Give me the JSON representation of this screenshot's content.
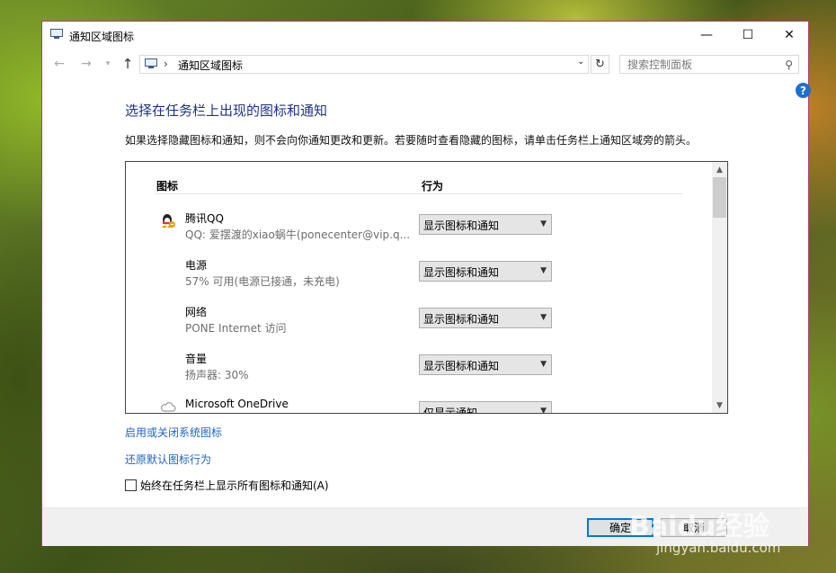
{
  "window": {
    "title": "通知区域图标",
    "controls": {
      "minimize": "—",
      "maximize": "☐",
      "close": "✕"
    }
  },
  "address": {
    "path": "通知区域图标",
    "search_placeholder": "搜索控制面板"
  },
  "main": {
    "heading": "选择在任务栏上出现的图标和通知",
    "description": "如果选择隐藏图标和通知，则不会向你通知更改和更新。若要随时查看隐藏的图标，请单击任务栏上通知区域旁的箭头。",
    "columns": {
      "icon": "图标",
      "action": "行为"
    },
    "rows": [
      {
        "icon": "qq-penguin-icon",
        "name": "腾讯QQ",
        "desc": "QQ: 爱摆渡的xiao蜗牛(ponecenter@vip.q...",
        "action": "显示图标和通知"
      },
      {
        "icon": "none",
        "name": "电源",
        "desc": "57% 可用(电源已接通，未充电)",
        "action": "显示图标和通知"
      },
      {
        "icon": "none",
        "name": "网络",
        "desc": "PONE Internet 访问",
        "action": "显示图标和通知"
      },
      {
        "icon": "none",
        "name": "音量",
        "desc": "扬声器: 30%",
        "action": "显示图标和通知"
      },
      {
        "icon": "cloud-icon",
        "name": "Microsoft OneDrive",
        "desc": "",
        "action": "仅显示通知"
      }
    ],
    "link_system_icons": "启用或关闭系统图标",
    "link_restore": "还原默认图标行为",
    "checkbox_label": "始终在任务栏上显示所有图标和通知(A)",
    "checkbox_checked": false
  },
  "footer": {
    "ok": "确定",
    "cancel": "取消"
  },
  "watermark": {
    "brand": "Baidu经验",
    "url": "jingyan.baidu.com"
  },
  "colors": {
    "heading": "#1e3287",
    "link": "#1e64c8",
    "window_border": "#b33b73",
    "focus": "#0078d7"
  }
}
